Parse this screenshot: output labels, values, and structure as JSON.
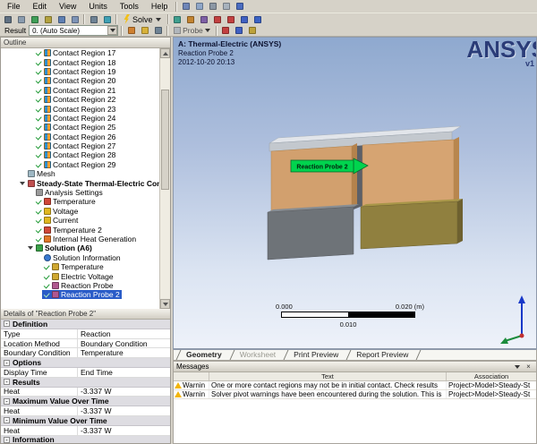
{
  "colors": {
    "selection": "#2a5cc8",
    "probe_label_green": "#00d44e",
    "warning_yellow": "#f2b50a",
    "viewport_top": "#8fa9cf",
    "viewport_bottom": "#eef2fa"
  },
  "menubar": {
    "items": [
      "File",
      "Edit",
      "View",
      "Units",
      "Tools",
      "Help"
    ],
    "extra_icons": [
      {
        "name": "back-icon",
        "color": "#6f86b8"
      },
      {
        "name": "forward-icon",
        "color": "#8fa6c8"
      },
      {
        "name": "print-icon",
        "color": "#8b97a4"
      },
      {
        "name": "copy-icon",
        "color": "#a7b2bd"
      },
      {
        "name": "help-context-icon",
        "color": "#4a6cc0"
      }
    ]
  },
  "toolbar_main": {
    "icons_select": [
      {
        "name": "select-cursor-icon",
        "color": "#5f7082"
      },
      {
        "name": "box-select-icon",
        "color": "#8a9cae"
      },
      {
        "name": "rotate-icon",
        "color": "#3f9e57"
      },
      {
        "name": "pan-icon",
        "color": "#b3a23f"
      },
      {
        "name": "zoom-icon",
        "color": "#5e7fb2"
      },
      {
        "name": "zoom-fit-icon",
        "color": "#7d93b6"
      }
    ],
    "icons_display": [
      {
        "name": "wireframe-icon",
        "color": "#6e8294"
      },
      {
        "name": "mesh-display-icon",
        "color": "#3fa0b4"
      }
    ],
    "solve_label": "Solve",
    "icons_tools": [
      {
        "name": "worksheet-icon",
        "color": "#3f9e8e"
      },
      {
        "name": "chart-icon",
        "color": "#c2832f"
      },
      {
        "name": "image-capture-icon",
        "color": "#7e5fa5"
      },
      {
        "name": "show-errors-icon",
        "color": "#c24040"
      },
      {
        "name": "max-annotation-icon",
        "color": "#c24040"
      },
      {
        "name": "min-annotation-icon",
        "color": "#4060c2"
      },
      {
        "name": "help-icon",
        "color": "#3a62c4"
      }
    ]
  },
  "toolbar_result": {
    "label": "Result",
    "scale_value": "0. (Auto Scale)",
    "icons_display": [
      {
        "name": "contour-bands-icon",
        "color": "#cf8030"
      },
      {
        "name": "smooth-contour-icon",
        "color": "#d8b23a"
      },
      {
        "name": "element-edges-icon",
        "color": "#6e8294"
      }
    ],
    "probe_label": "Probe",
    "icons_probe": [
      {
        "name": "max-probe-icon",
        "color": "#c24040"
      },
      {
        "name": "min-probe-icon",
        "color": "#4060c2"
      },
      {
        "name": "timeline-chart-icon",
        "color": "#bda23b"
      }
    ]
  },
  "outline": {
    "title": "Outline",
    "items": [
      {
        "label": "Contact Region 17",
        "depth": 3,
        "icon": "contact",
        "check": true
      },
      {
        "label": "Contact Region 18",
        "depth": 3,
        "icon": "contact",
        "check": true
      },
      {
        "label": "Contact Region 19",
        "depth": 3,
        "icon": "contact",
        "check": true
      },
      {
        "label": "Contact Region 20",
        "depth": 3,
        "icon": "contact",
        "check": true
      },
      {
        "label": "Contact Region 21",
        "depth": 3,
        "icon": "contact",
        "check": true
      },
      {
        "label": "Contact Region 22",
        "depth": 3,
        "icon": "contact",
        "check": true
      },
      {
        "label": "Contact Region 23",
        "depth": 3,
        "icon": "contact",
        "check": true
      },
      {
        "label": "Contact Region 24",
        "depth": 3,
        "icon": "contact",
        "check": true
      },
      {
        "label": "Contact Region 25",
        "depth": 3,
        "icon": "contact",
        "check": true
      },
      {
        "label": "Contact Region 26",
        "depth": 3,
        "icon": "contact",
        "check": true
      },
      {
        "label": "Contact Region 27",
        "depth": 3,
        "icon": "contact",
        "check": true
      },
      {
        "label": "Contact Region 28",
        "depth": 3,
        "icon": "contact",
        "check": true
      },
      {
        "label": "Contact Region 29",
        "depth": 3,
        "icon": "contact",
        "check": true
      },
      {
        "label": "Mesh",
        "depth": 2,
        "icon": "mesh"
      },
      {
        "label": "Steady-State Thermal-Electric Con",
        "depth": 2,
        "icon": "analysis",
        "bold": true,
        "expander": true
      },
      {
        "label": "Analysis Settings",
        "depth": 3,
        "icon": "settings"
      },
      {
        "label": "Temperature",
        "depth": 3,
        "icon": "temperature",
        "check": true
      },
      {
        "label": "Voltage",
        "depth": 3,
        "icon": "voltage",
        "check": true
      },
      {
        "label": "Current",
        "depth": 3,
        "icon": "current",
        "check": true
      },
      {
        "label": "Temperature 2",
        "depth": 3,
        "icon": "temperature",
        "check": true
      },
      {
        "label": "Internal Heat Generation",
        "depth": 3,
        "icon": "heat",
        "check": true
      },
      {
        "label": "Solution (A6)",
        "depth": 3,
        "icon": "solution",
        "bold": true,
        "expander": true
      },
      {
        "label": "Solution Information",
        "depth": 4,
        "icon": "info"
      },
      {
        "label": "Temperature",
        "depth": 4,
        "icon": "result",
        "check": true
      },
      {
        "label": "Electric Voltage",
        "depth": 4,
        "icon": "result",
        "check": true
      },
      {
        "label": "Reaction Probe",
        "depth": 4,
        "icon": "probe",
        "check": true
      },
      {
        "label": "Reaction Probe 2",
        "depth": 4,
        "icon": "probe",
        "check": true,
        "selected": true
      }
    ]
  },
  "details": {
    "title": "Details of \"Reaction Probe 2\"",
    "rows": [
      {
        "kind": "category",
        "label": "Definition"
      },
      {
        "kind": "item",
        "label": "Type",
        "value": "Reaction"
      },
      {
        "kind": "item",
        "label": "Location Method",
        "value": "Boundary Condition"
      },
      {
        "kind": "item",
        "label": "Boundary Condition",
        "value": "Temperature"
      },
      {
        "kind": "category",
        "label": "Options"
      },
      {
        "kind": "item",
        "label": "Display Time",
        "value": "End Time"
      },
      {
        "kind": "category",
        "label": "Results"
      },
      {
        "kind": "item",
        "label": "Heat",
        "value": "-3.337 W"
      },
      {
        "kind": "category",
        "label": "Maximum Value Over Time"
      },
      {
        "kind": "item",
        "label": "Heat",
        "value": "-3.337 W"
      },
      {
        "kind": "category",
        "label": "Minimum Value Over Time"
      },
      {
        "kind": "item",
        "label": "Heat",
        "value": "-3.337 W"
      },
      {
        "kind": "category",
        "label": "Information"
      }
    ]
  },
  "viewport": {
    "title": "A: Thermal-Electric (ANSYS)",
    "subtitle": "Reaction Probe 2",
    "date": "2012-10-20 20:13",
    "brand": "ANSYS",
    "brand_version": "v1",
    "probe_annotation": "Reaction Probe 2",
    "ruler": {
      "min": "0.000",
      "mid": "0.010",
      "max": "0.020 (m)"
    }
  },
  "tabs": [
    {
      "label": "Geometry",
      "state": "active"
    },
    {
      "label": "Worksheet",
      "state": "disabled"
    },
    {
      "label": "Print Preview",
      "state": "normal"
    },
    {
      "label": "Report Preview",
      "state": "normal"
    }
  ],
  "messages": {
    "title": "Messages",
    "columns": {
      "text": "Text",
      "association": "Association"
    },
    "rows": [
      {
        "severity": "Warnin",
        "text": "One or more contact regions may not be in initial contact.  Check results",
        "association": "Project>Model>Steady-St"
      },
      {
        "severity": "Warnin",
        "text": "Solver pivot warnings have been encountered during the solution.  This is",
        "association": "Project>Model>Steady-St"
      }
    ]
  }
}
